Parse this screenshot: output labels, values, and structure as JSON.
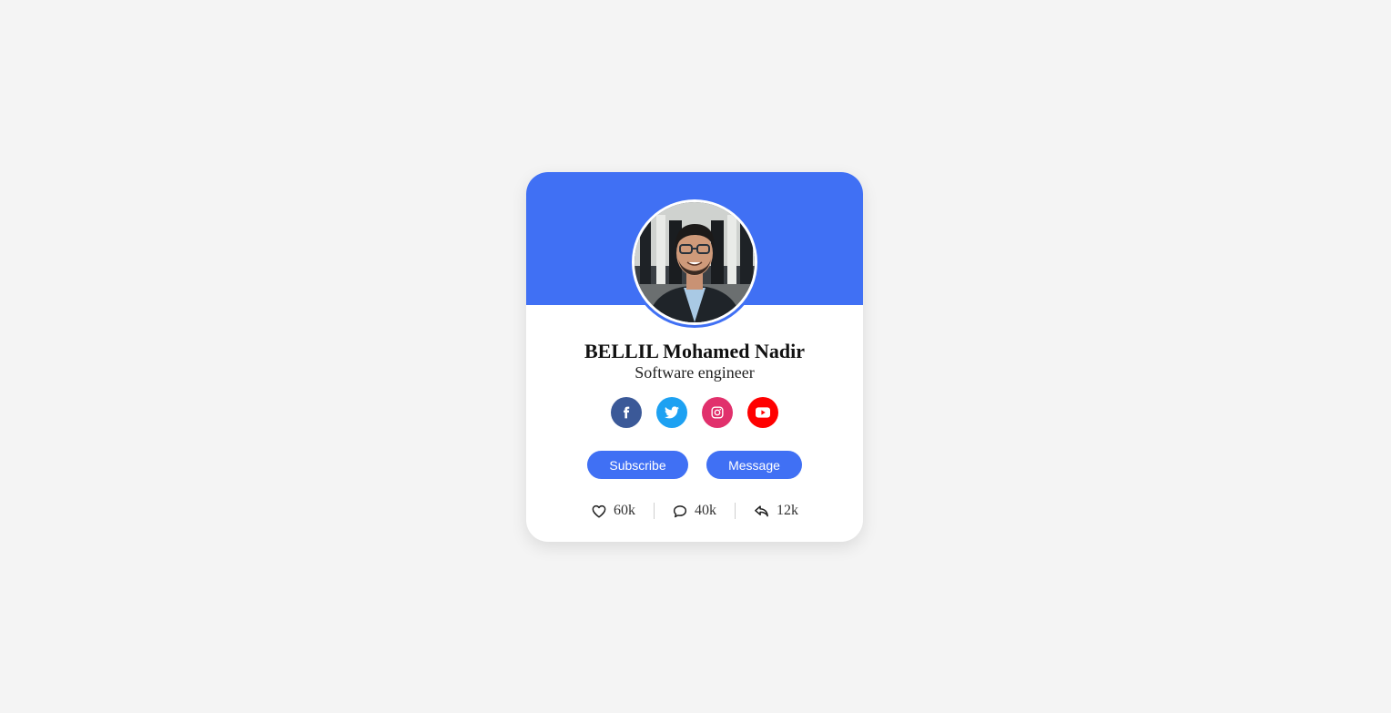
{
  "profile": {
    "name": "BELLIL Mohamed Nadir",
    "job": "Software engineer",
    "photo_icon": "profile-photo"
  },
  "socials": [
    {
      "name": "facebook-icon",
      "color": "#3b5998"
    },
    {
      "name": "twitter-icon",
      "color": "#1da1f2"
    },
    {
      "name": "instagram-icon",
      "color": "#e1306c"
    },
    {
      "name": "youtube-icon",
      "color": "#ff0000"
    }
  ],
  "buttons": {
    "subscribe": "Subscribe",
    "message": "Message"
  },
  "stats": {
    "likes": "60k",
    "comments": "40k",
    "shares": "12k"
  },
  "colors": {
    "accent": "#4070f4",
    "background": "#f4f4f4"
  }
}
